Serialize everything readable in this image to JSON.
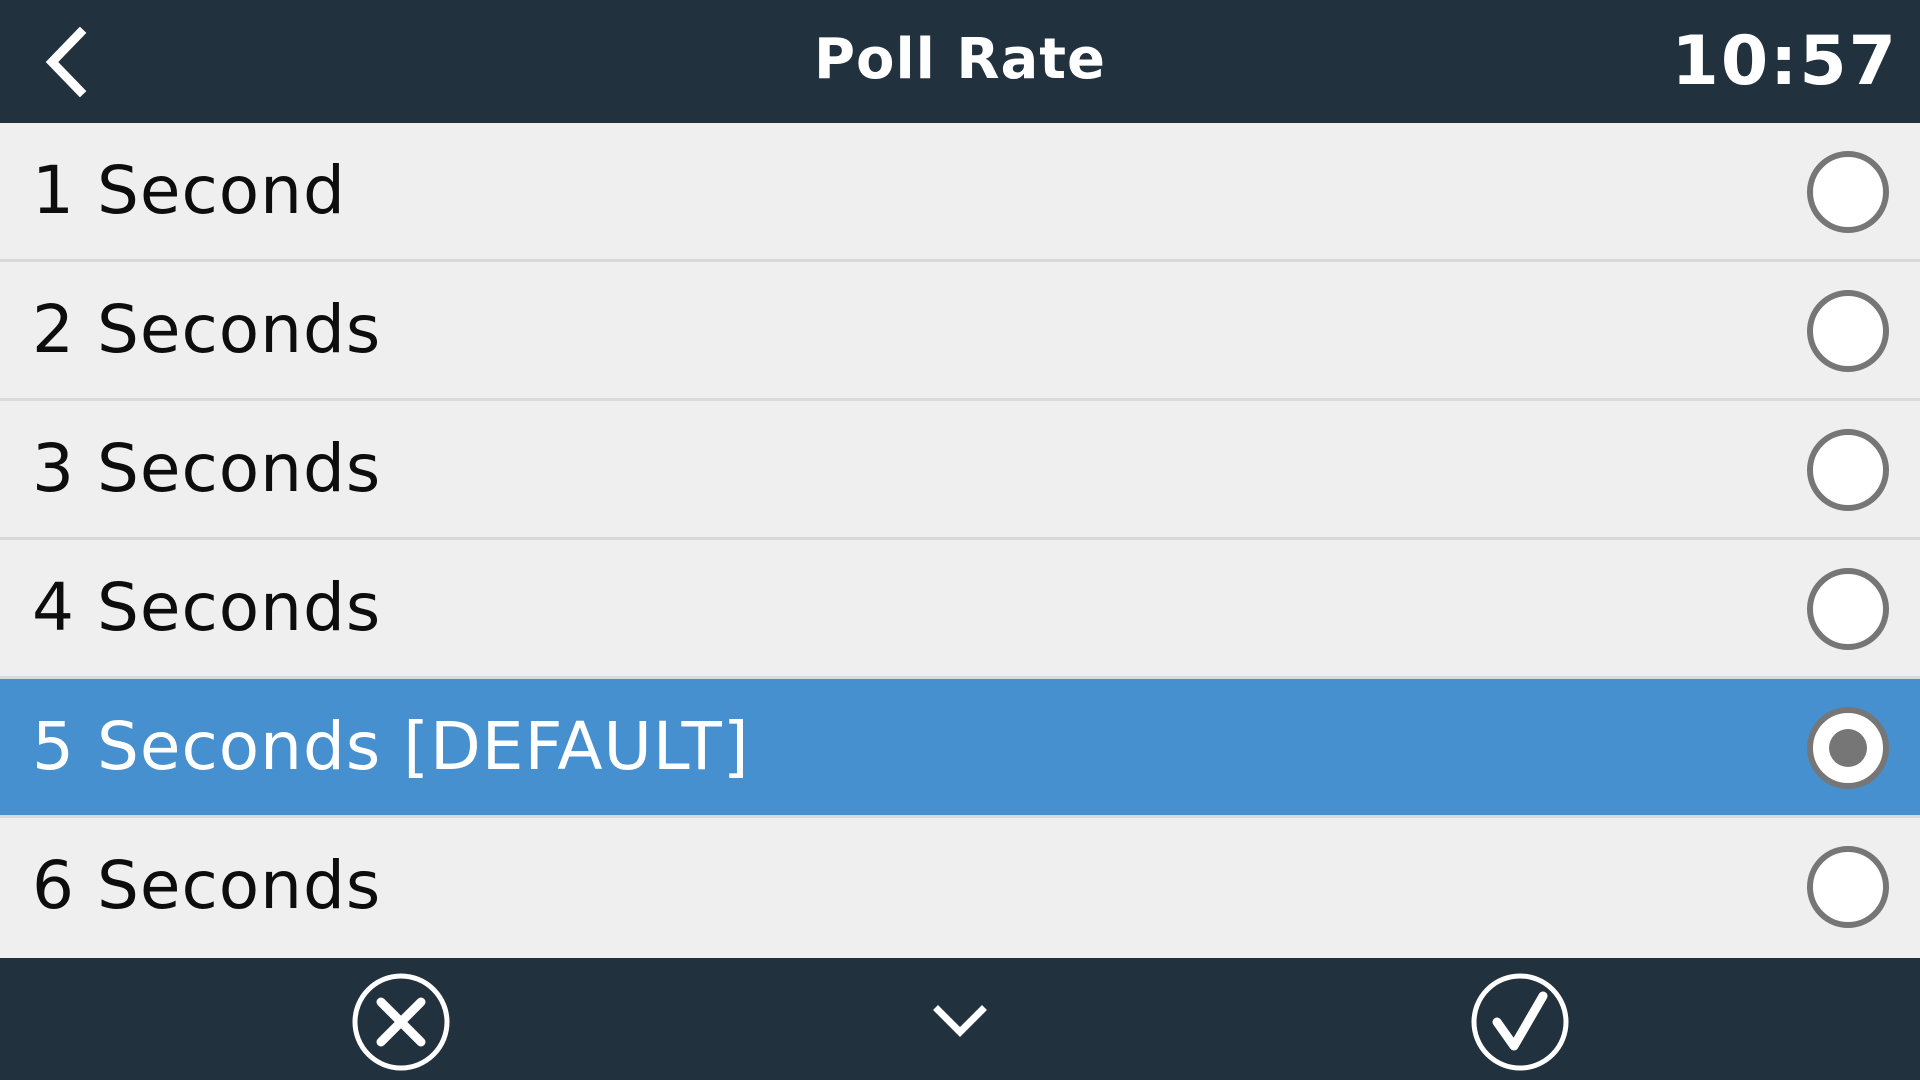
{
  "header": {
    "title": "Poll Rate",
    "clock": "10:57",
    "back_icon": "chevron-left-icon"
  },
  "options": [
    {
      "label": "1 Second",
      "selected": false
    },
    {
      "label": "2 Seconds",
      "selected": false
    },
    {
      "label": "3 Seconds",
      "selected": false
    },
    {
      "label": "4 Seconds",
      "selected": false
    },
    {
      "label": "5 Seconds [DEFAULT]",
      "selected": true
    },
    {
      "label": "6 Seconds",
      "selected": false
    }
  ],
  "footer": {
    "cancel_icon": "close-circle-icon",
    "scroll_icon": "chevron-down-icon",
    "confirm_icon": "check-circle-icon"
  },
  "colors": {
    "bar_bg": "#22313e",
    "list_bg": "#efefef",
    "selected_bg": "#4790cf",
    "radio_ring": "#767676"
  }
}
